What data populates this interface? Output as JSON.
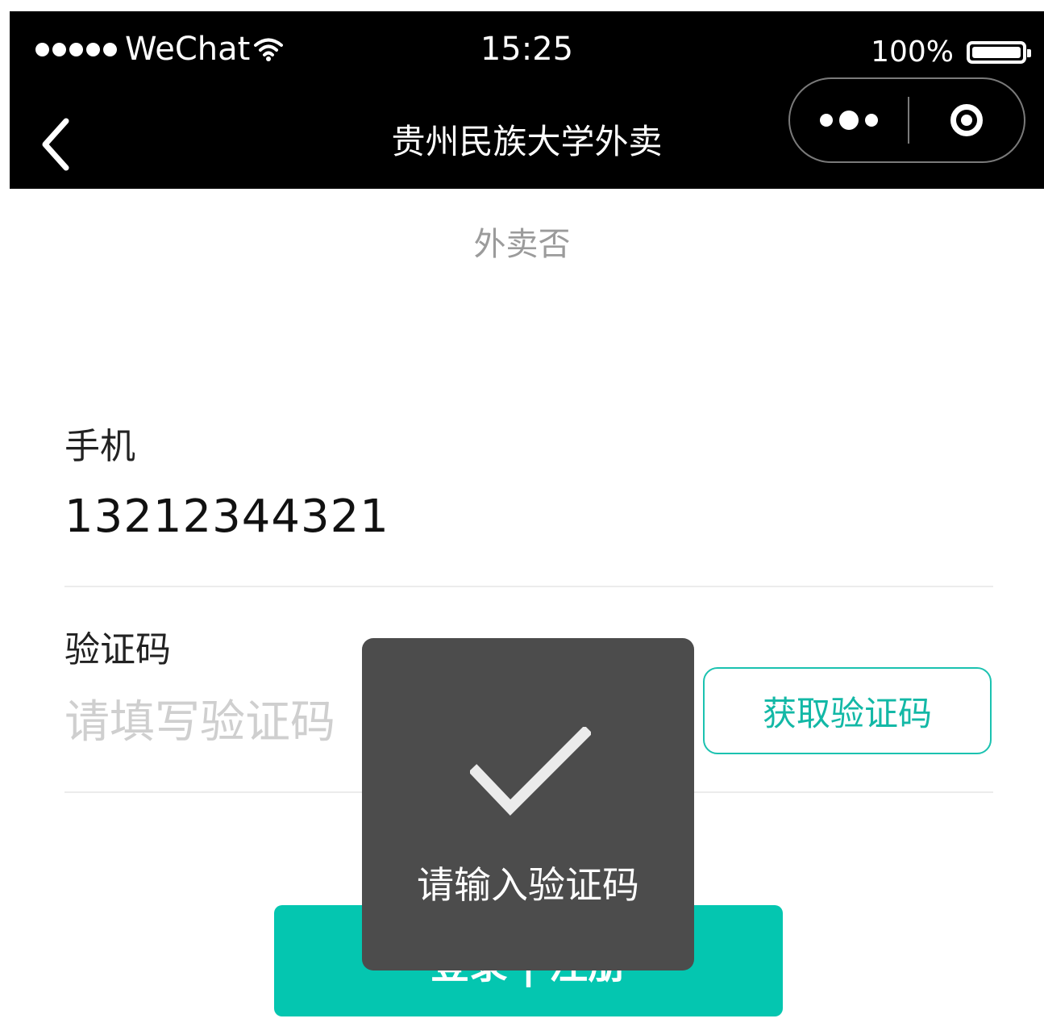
{
  "status_bar": {
    "carrier": "WeChat",
    "time": "15:25",
    "battery": "100%",
    "signal_bars": 5,
    "battery_level": 1.0
  },
  "nav": {
    "title": "贵州民族大学外卖"
  },
  "page": {
    "brand": "外卖否",
    "phone_label": "手机",
    "phone_value": "13212344321",
    "code_label": "验证码",
    "code_placeholder": "请填写验证码",
    "get_code_label": "获取验证码",
    "login_label": "登录 | 注册"
  },
  "toast": {
    "icon": "check-icon",
    "message": "请输入验证码"
  },
  "colors": {
    "accent": "#04c6b0",
    "accent_text": "#13b8a6",
    "toast_bg": "#4c4c4c",
    "bar_bg": "#000000"
  }
}
